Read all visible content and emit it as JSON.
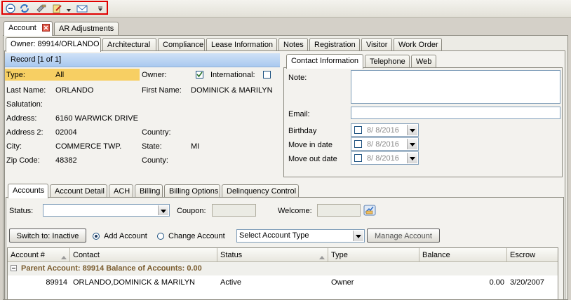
{
  "toolbar": {
    "icons": [
      "minus-circle-icon",
      "refresh-icon",
      "tools-icon",
      "notes-icon",
      "email-icon",
      "more-icon"
    ],
    "highlight_color": "#e00000"
  },
  "main_tabs": [
    {
      "label": "Account",
      "active": true
    },
    {
      "label": "AR Adjustments",
      "active": false
    }
  ],
  "sub_tabs": [
    {
      "label": "Owner: 89914/ORLANDO",
      "active": true
    },
    {
      "label": "Architectural"
    },
    {
      "label": "Compliance"
    },
    {
      "label": "Lease Information"
    },
    {
      "label": "Notes"
    },
    {
      "label": "Registration"
    },
    {
      "label": "Visitor"
    },
    {
      "label": "Work Order"
    }
  ],
  "record": {
    "header": "Record [1 of 1]",
    "type_label": "Type:",
    "type_value": "All",
    "owner_label": "Owner:",
    "owner_checked": true,
    "international_label": "International:",
    "international_checked": false,
    "last_name_label": "Last Name:",
    "last_name": "ORLANDO",
    "first_name_label": "First Name:",
    "first_name": "DOMINICK & MARILYN",
    "salutation_label": "Salutation:",
    "address_label": "Address:",
    "address": "6160 WARWICK DRIVE",
    "address2_label": "Address 2:",
    "address2": "02004",
    "country_label": "Country:",
    "city_label": "City:",
    "city": "COMMERCE TWP.",
    "state_label": "State:",
    "state": "MI",
    "zip_label": "Zip Code:",
    "zip": "48382",
    "county_label": "County:"
  },
  "contact_tabs": [
    {
      "label": "Contact Information",
      "active": true
    },
    {
      "label": "Telephone"
    },
    {
      "label": "Web"
    }
  ],
  "contact": {
    "note_label": "Note:",
    "email_label": "Email:",
    "birthday_label": "Birthday",
    "birthday": "8/  8/2016",
    "move_in_label": "Move in date",
    "move_in": "8/  8/2016",
    "move_out_label": "Move out date",
    "move_out": "8/  8/2016"
  },
  "account_tabs": [
    {
      "label": "Accounts",
      "active": true
    },
    {
      "label": "Account Detail"
    },
    {
      "label": "ACH"
    },
    {
      "label": "Billing"
    },
    {
      "label": "Billing Options"
    },
    {
      "label": "Delinquency Control"
    }
  ],
  "accounts": {
    "status_label": "Status:",
    "coupon_label": "Coupon:",
    "welcome_label": "Welcome:",
    "switch_button": "Switch to: Inactive",
    "add_account_label": "Add Account",
    "change_account_label": "Change Account",
    "select_account_type": "Select Account Type",
    "manage_button": "Manage Account"
  },
  "grid": {
    "columns": [
      "Account #",
      "Contact",
      "Status",
      "Type",
      "Balance",
      "Escrow"
    ],
    "group_label": "Parent Account: 89914 Balance of Accounts: 0.00",
    "rows": [
      {
        "account": "89914",
        "contact": "ORLANDO,DOMINICK & MARILYN",
        "status": "Active",
        "type": "Owner",
        "balance": "0.00",
        "escrow": "3/20/2007"
      }
    ]
  }
}
